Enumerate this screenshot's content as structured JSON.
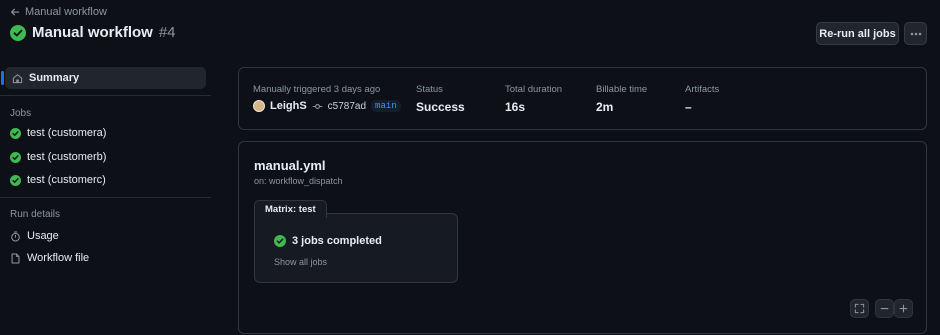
{
  "header": {
    "back_label": "Manual workflow",
    "title": "Manual workflow",
    "run_number": "#4",
    "rerun_label": "Re-run all jobs"
  },
  "sidebar": {
    "summary_label": "Summary",
    "jobs_heading": "Jobs",
    "jobs": [
      {
        "label": "test (customera)",
        "status": "success"
      },
      {
        "label": "test (customerb)",
        "status": "success"
      },
      {
        "label": "test (customerc)",
        "status": "success"
      }
    ],
    "run_details_heading": "Run details",
    "details": [
      {
        "label": "Usage",
        "icon": "stopwatch-icon"
      },
      {
        "label": "Workflow file",
        "icon": "file-icon"
      }
    ]
  },
  "summary": {
    "trigger_text": "Manually triggered 3 days ago",
    "actor": "LeighS",
    "commit_sha": "c5787ad",
    "branch": "main",
    "status_label": "Status",
    "status_value": "Success",
    "duration_label": "Total duration",
    "duration_value": "16s",
    "billable_label": "Billable time",
    "billable_value": "2m",
    "artifacts_label": "Artifacts",
    "artifacts_value": "–"
  },
  "graph": {
    "workflow_file": "manual.yml",
    "trigger": "on: workflow_dispatch",
    "matrix_label": "Matrix: test",
    "jobs_completed": "3 jobs completed",
    "show_all": "Show all jobs"
  },
  "colors": {
    "success": "#3fb950",
    "accent": "#1f6feb",
    "background": "#0d1117"
  }
}
